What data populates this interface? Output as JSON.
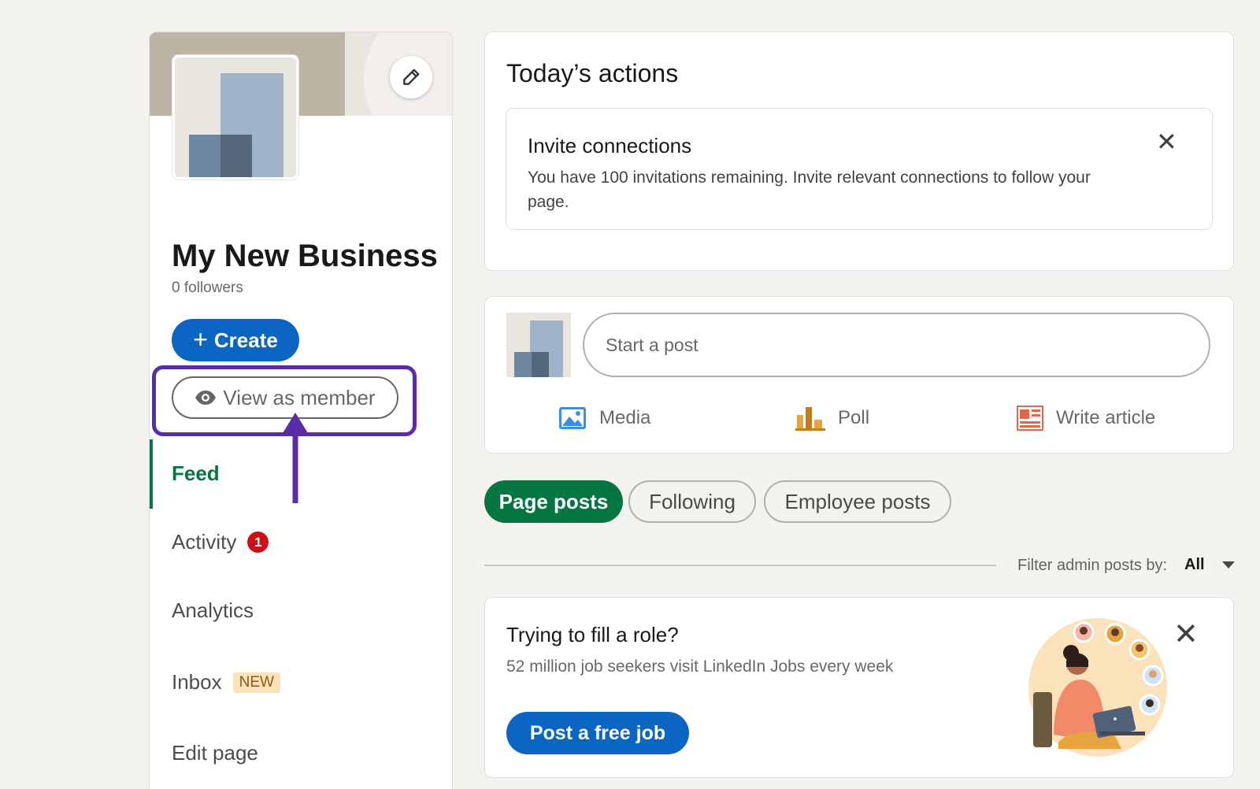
{
  "sidebar": {
    "business_name": "My New Business",
    "followers": "0 followers",
    "create_label": "Create",
    "view_as_member_label": "View as member",
    "nav": [
      {
        "label": "Feed",
        "active": true
      },
      {
        "label": "Activity",
        "badge": "1"
      },
      {
        "label": "Analytics"
      },
      {
        "label": "Inbox",
        "badge": "NEW"
      },
      {
        "label": "Edit page"
      }
    ]
  },
  "todays_actions": {
    "title": "Today’s actions",
    "invite": {
      "title": "Invite connections",
      "text": "You have 100 invitations remaining. Invite relevant connections to follow your page."
    }
  },
  "composer": {
    "placeholder": "Start a post",
    "actions": [
      {
        "label": "Media",
        "icon": "image-icon"
      },
      {
        "label": "Poll",
        "icon": "poll-icon"
      },
      {
        "label": "Write article",
        "icon": "article-icon"
      }
    ]
  },
  "tabs": [
    "Page posts",
    "Following",
    "Employee posts"
  ],
  "filter": {
    "label": "Filter admin posts by:",
    "value": "All"
  },
  "job_promo": {
    "title": "Trying to fill a role?",
    "subtitle": "52 million job seekers visit LinkedIn Jobs every week",
    "button": "Post a free job"
  },
  "colors": {
    "primary_blue": "#0a66c2",
    "active_green": "#057642",
    "highlight_purple": "#5a2ca8",
    "badge_red": "#cc1016",
    "background": "#f3f2ef"
  }
}
